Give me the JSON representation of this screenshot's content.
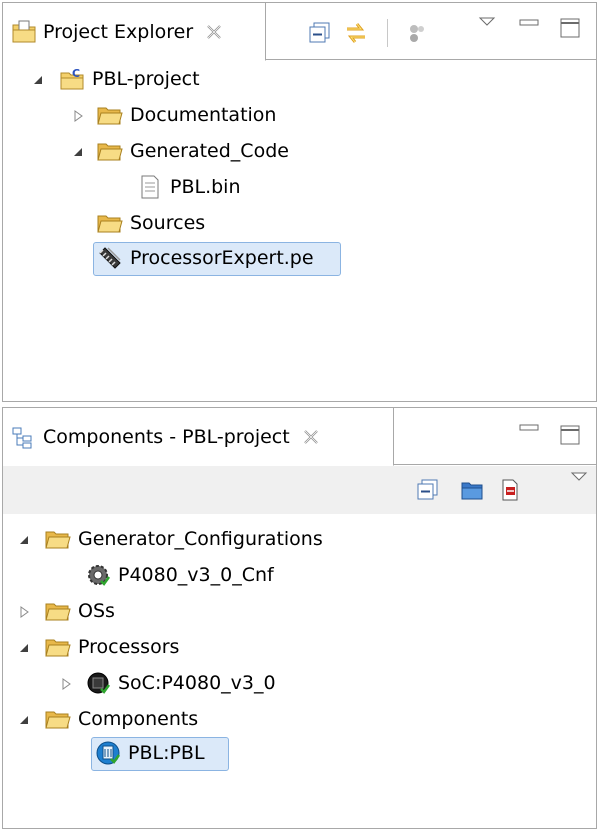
{
  "explorer": {
    "tab_label": "Project Explorer",
    "tree": [
      {
        "label": "PBL-project",
        "expanded": true,
        "icon": "c-project-icon"
      },
      {
        "label": "Documentation",
        "expanded": false,
        "icon": "folder-icon"
      },
      {
        "label": "Generated_Code",
        "expanded": true,
        "icon": "folder-icon"
      },
      {
        "label": "PBL.bin",
        "icon": "file-icon"
      },
      {
        "label": "Sources",
        "icon": "folder-icon"
      },
      {
        "label": "ProcessorExpert.pe",
        "icon": "processor-expert-icon",
        "selected": true
      }
    ]
  },
  "components": {
    "tab_label": "Components - PBL-project",
    "tree": [
      {
        "label": "Generator_Configurations",
        "expanded": true,
        "icon": "folder-icon"
      },
      {
        "label": "P4080_v3_0_Cnf",
        "icon": "gear-config-icon"
      },
      {
        "label": "OSs",
        "expanded": false,
        "icon": "folder-icon"
      },
      {
        "label": "Processors",
        "expanded": true,
        "icon": "folder-icon"
      },
      {
        "label": "SoC:P4080_v3_0",
        "expanded": false,
        "icon": "chip-icon"
      },
      {
        "label": "Components",
        "expanded": true,
        "icon": "folder-icon"
      },
      {
        "label": "PBL:PBL",
        "icon": "component-icon",
        "selected": true
      }
    ]
  },
  "colors": {
    "folder": "#f4d06b",
    "selection_bg": "#dbe9f9",
    "selection_border": "#8bb4e2",
    "border": "#a8a8a8"
  }
}
